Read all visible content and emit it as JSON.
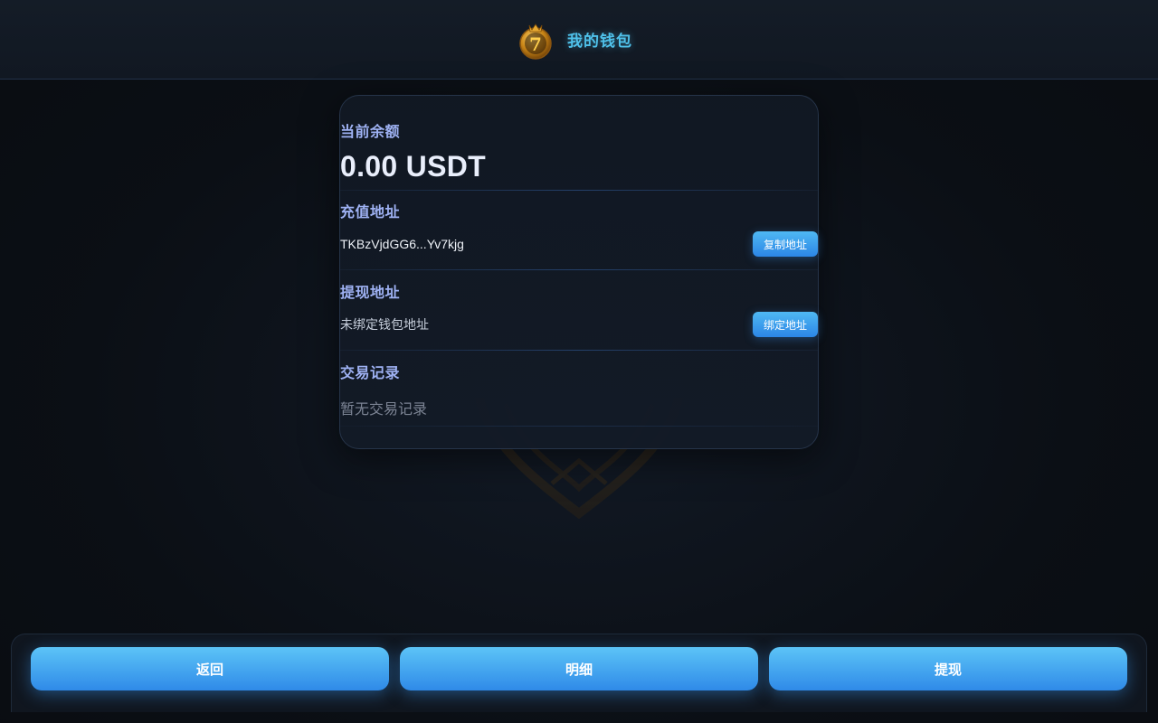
{
  "header": {
    "logo_icon": "lucky-seven-badge-icon",
    "title": "我的钱包"
  },
  "colors": {
    "accent": "#4fc1ea",
    "label": "#9fb2f4",
    "button_top": "#5cc4f7",
    "button_bottom": "#2f8ae8",
    "background": "#0b0f15"
  },
  "wallet": {
    "balance_label": "当前余额",
    "balance_value": "0.00 USDT",
    "deposit": {
      "label": "充值地址",
      "address": "TKBzVjdGG6...Yv7kjg",
      "button": "复制地址"
    },
    "withdraw": {
      "label": "提现地址",
      "address": "未绑定钱包地址",
      "button": "绑定地址"
    },
    "transactions": {
      "label": "交易记录",
      "empty_text": "暂无交易记录"
    }
  },
  "bottom_bar": {
    "back": "返回",
    "details": "明细",
    "withdraw": "提现"
  }
}
